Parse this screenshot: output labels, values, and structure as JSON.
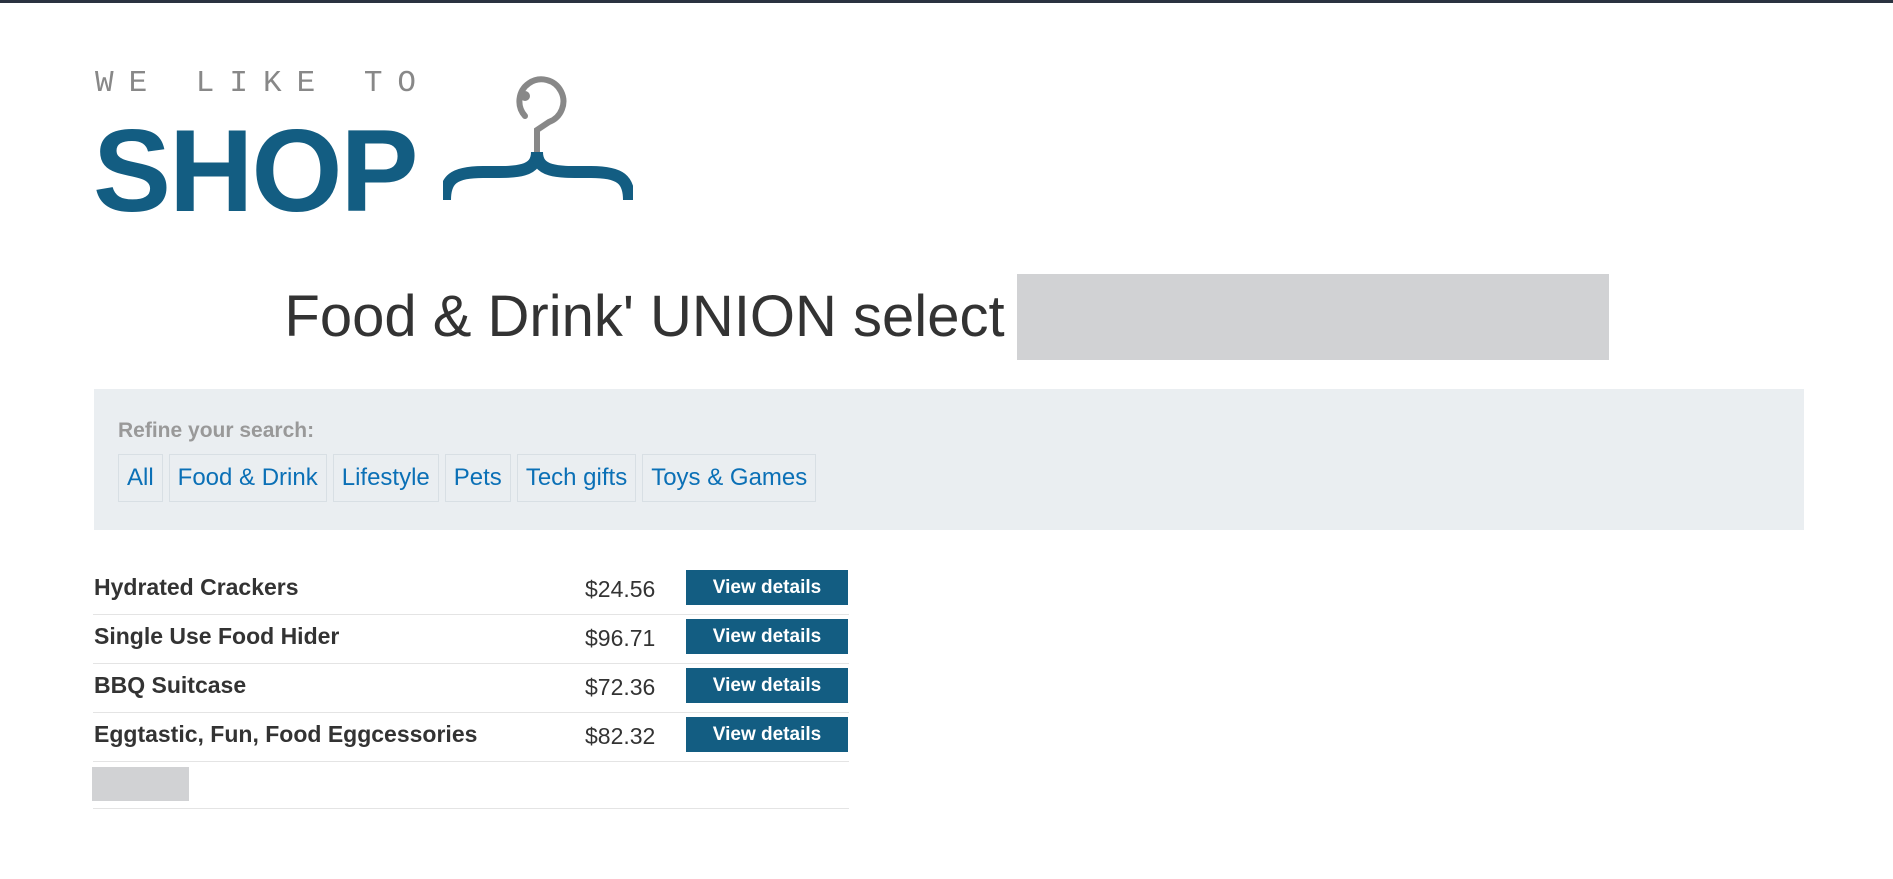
{
  "logo": {
    "tagline": "WE LIKE TO",
    "word": "SHOP",
    "icon": "hanger-icon"
  },
  "heading": {
    "text": "Food & Drink' UNION select"
  },
  "filters": {
    "label": "Refine your search:",
    "items": [
      {
        "label": "All"
      },
      {
        "label": "Food & Drink"
      },
      {
        "label": "Lifestyle"
      },
      {
        "label": "Pets"
      },
      {
        "label": "Tech gifts"
      },
      {
        "label": "Toys & Games"
      }
    ]
  },
  "products": [
    {
      "name": "Hydrated Crackers",
      "price": "$24.56",
      "button": "View details"
    },
    {
      "name": "Single Use Food Hider",
      "price": "$96.71",
      "button": "View details"
    },
    {
      "name": "BBQ Suitcase",
      "price": "$72.36",
      "button": "View details"
    },
    {
      "name": "Eggtastic, Fun, Food Eggcessories",
      "price": "$82.32",
      "button": "View details"
    }
  ],
  "colors": {
    "brand": "#135d82",
    "link": "#0b70b6",
    "panel": "#eaeef1",
    "redacted": "#d1d2d4"
  }
}
